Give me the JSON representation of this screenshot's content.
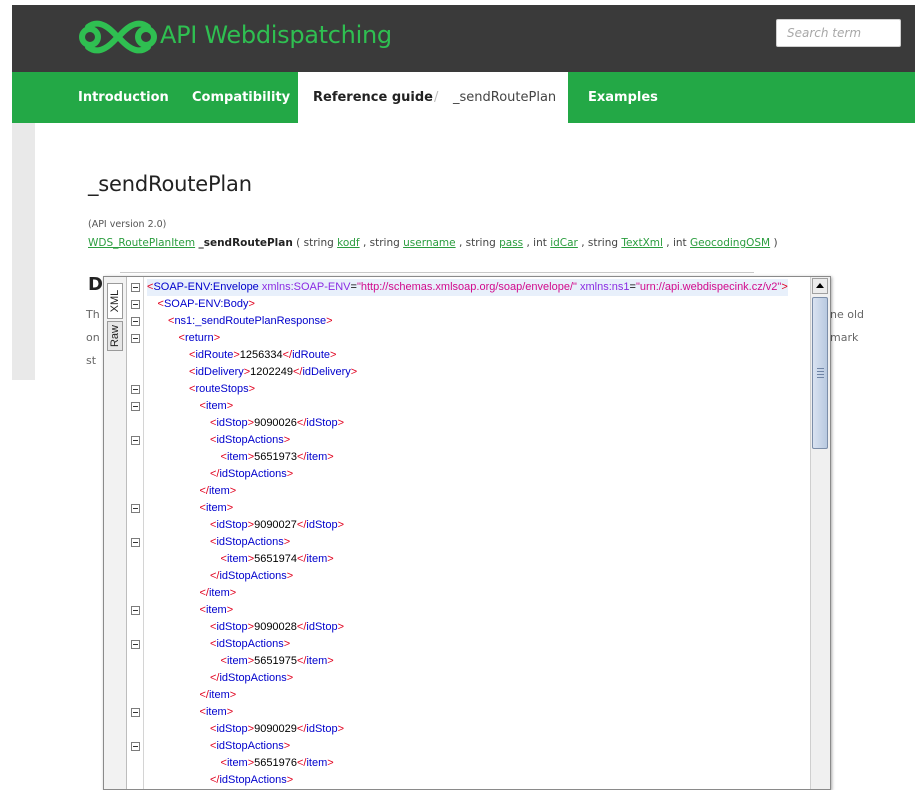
{
  "header": {
    "title": "API Webdispatching",
    "search_placeholder": "Search term",
    "brand_color": "#2fbf51"
  },
  "nav": {
    "items": [
      "Introduction",
      "Compatibility"
    ],
    "breadcrumb": {
      "section": "Reference guide",
      "separator": "/",
      "current": "_sendRoutePlan"
    },
    "examples": "Examples"
  },
  "content": {
    "title": "_sendRoutePlan",
    "api_version": "(API version 2.0)",
    "signature": {
      "return_type": "WDS_RoutePlanItem",
      "function": "_sendRoutePlan",
      "open": " ( ",
      "close": " )",
      "params": [
        {
          "type": "string",
          "name": "kodf"
        },
        {
          "type": "string",
          "name": "username"
        },
        {
          "type": "string",
          "name": "pass"
        },
        {
          "type": "int",
          "name": "idCar"
        },
        {
          "type": "string",
          "name": "TextXml"
        },
        {
          "type": "int",
          "name": "GeocodingOSM"
        }
      ]
    },
    "section_heading_partial": "D",
    "desc_partial": [
      "Th",
      "on",
      "st"
    ],
    "desc_right_partial": [
      "ne old",
      "mark"
    ]
  },
  "viewer": {
    "tabs": [
      "XML",
      "Raw"
    ],
    "lines": [
      {
        "indent": 0,
        "fold": true,
        "hl": true,
        "parts": [
          [
            "br",
            "<"
          ],
          [
            "tg",
            "SOAP-ENV:Envelope"
          ],
          [
            "at",
            " xmlns:SOAP-ENV"
          ],
          [
            "tx",
            "="
          ],
          [
            "av",
            "\"http://schemas.xmlsoap.org/soap/envelope/\""
          ],
          [
            "at",
            " xmlns:ns1"
          ],
          [
            "tx",
            "="
          ],
          [
            "av",
            "\"urn://api.webdispecink.cz/v2\""
          ],
          [
            "br",
            ">"
          ]
        ]
      },
      {
        "indent": 1,
        "fold": true,
        "hl": false,
        "parts": [
          [
            "br",
            "<"
          ],
          [
            "tg",
            "SOAP-ENV:Body"
          ],
          [
            "br",
            ">"
          ]
        ]
      },
      {
        "indent": 2,
        "fold": true,
        "hl": false,
        "parts": [
          [
            "br",
            "<"
          ],
          [
            "tg",
            "ns1:_sendRoutePlanResponse"
          ],
          [
            "br",
            ">"
          ]
        ]
      },
      {
        "indent": 3,
        "fold": true,
        "hl": false,
        "parts": [
          [
            "br",
            "<"
          ],
          [
            "tg",
            "return"
          ],
          [
            "br",
            ">"
          ]
        ]
      },
      {
        "indent": 4,
        "fold": false,
        "hl": false,
        "parts": [
          [
            "br",
            "<"
          ],
          [
            "tg",
            "idRoute"
          ],
          [
            "br",
            ">"
          ],
          [
            "tx",
            "1256334"
          ],
          [
            "br",
            "</"
          ],
          [
            "tg",
            "idRoute"
          ],
          [
            "br",
            ">"
          ]
        ]
      },
      {
        "indent": 4,
        "fold": false,
        "hl": false,
        "parts": [
          [
            "br",
            "<"
          ],
          [
            "tg",
            "idDelivery"
          ],
          [
            "br",
            ">"
          ],
          [
            "tx",
            "1202249"
          ],
          [
            "br",
            "</"
          ],
          [
            "tg",
            "idDelivery"
          ],
          [
            "br",
            ">"
          ]
        ]
      },
      {
        "indent": 4,
        "fold": true,
        "hl": false,
        "parts": [
          [
            "br",
            "<"
          ],
          [
            "tg",
            "routeStops"
          ],
          [
            "br",
            ">"
          ]
        ]
      },
      {
        "indent": 5,
        "fold": true,
        "hl": false,
        "parts": [
          [
            "br",
            "<"
          ],
          [
            "tg",
            "item"
          ],
          [
            "br",
            ">"
          ]
        ]
      },
      {
        "indent": 6,
        "fold": false,
        "hl": false,
        "parts": [
          [
            "br",
            "<"
          ],
          [
            "tg",
            "idStop"
          ],
          [
            "br",
            ">"
          ],
          [
            "tx",
            "9090026"
          ],
          [
            "br",
            "</"
          ],
          [
            "tg",
            "idStop"
          ],
          [
            "br",
            ">"
          ]
        ]
      },
      {
        "indent": 6,
        "fold": true,
        "hl": false,
        "parts": [
          [
            "br",
            "<"
          ],
          [
            "tg",
            "idStopActions"
          ],
          [
            "br",
            ">"
          ]
        ]
      },
      {
        "indent": 7,
        "fold": false,
        "hl": false,
        "parts": [
          [
            "br",
            "<"
          ],
          [
            "tg",
            "item"
          ],
          [
            "br",
            ">"
          ],
          [
            "tx",
            "5651973"
          ],
          [
            "br",
            "</"
          ],
          [
            "tg",
            "item"
          ],
          [
            "br",
            ">"
          ]
        ]
      },
      {
        "indent": 6,
        "fold": false,
        "hl": false,
        "parts": [
          [
            "br",
            "</"
          ],
          [
            "tg",
            "idStopActions"
          ],
          [
            "br",
            ">"
          ]
        ]
      },
      {
        "indent": 5,
        "fold": false,
        "hl": false,
        "parts": [
          [
            "br",
            "</"
          ],
          [
            "tg",
            "item"
          ],
          [
            "br",
            ">"
          ]
        ]
      },
      {
        "indent": 5,
        "fold": true,
        "hl": false,
        "parts": [
          [
            "br",
            "<"
          ],
          [
            "tg",
            "item"
          ],
          [
            "br",
            ">"
          ]
        ]
      },
      {
        "indent": 6,
        "fold": false,
        "hl": false,
        "parts": [
          [
            "br",
            "<"
          ],
          [
            "tg",
            "idStop"
          ],
          [
            "br",
            ">"
          ],
          [
            "tx",
            "9090027"
          ],
          [
            "br",
            "</"
          ],
          [
            "tg",
            "idStop"
          ],
          [
            "br",
            ">"
          ]
        ]
      },
      {
        "indent": 6,
        "fold": true,
        "hl": false,
        "parts": [
          [
            "br",
            "<"
          ],
          [
            "tg",
            "idStopActions"
          ],
          [
            "br",
            ">"
          ]
        ]
      },
      {
        "indent": 7,
        "fold": false,
        "hl": false,
        "parts": [
          [
            "br",
            "<"
          ],
          [
            "tg",
            "item"
          ],
          [
            "br",
            ">"
          ],
          [
            "tx",
            "5651974"
          ],
          [
            "br",
            "</"
          ],
          [
            "tg",
            "item"
          ],
          [
            "br",
            ">"
          ]
        ]
      },
      {
        "indent": 6,
        "fold": false,
        "hl": false,
        "parts": [
          [
            "br",
            "</"
          ],
          [
            "tg",
            "idStopActions"
          ],
          [
            "br",
            ">"
          ]
        ]
      },
      {
        "indent": 5,
        "fold": false,
        "hl": false,
        "parts": [
          [
            "br",
            "</"
          ],
          [
            "tg",
            "item"
          ],
          [
            "br",
            ">"
          ]
        ]
      },
      {
        "indent": 5,
        "fold": true,
        "hl": false,
        "parts": [
          [
            "br",
            "<"
          ],
          [
            "tg",
            "item"
          ],
          [
            "br",
            ">"
          ]
        ]
      },
      {
        "indent": 6,
        "fold": false,
        "hl": false,
        "parts": [
          [
            "br",
            "<"
          ],
          [
            "tg",
            "idStop"
          ],
          [
            "br",
            ">"
          ],
          [
            "tx",
            "9090028"
          ],
          [
            "br",
            "</"
          ],
          [
            "tg",
            "idStop"
          ],
          [
            "br",
            ">"
          ]
        ]
      },
      {
        "indent": 6,
        "fold": true,
        "hl": false,
        "parts": [
          [
            "br",
            "<"
          ],
          [
            "tg",
            "idStopActions"
          ],
          [
            "br",
            ">"
          ]
        ]
      },
      {
        "indent": 7,
        "fold": false,
        "hl": false,
        "parts": [
          [
            "br",
            "<"
          ],
          [
            "tg",
            "item"
          ],
          [
            "br",
            ">"
          ],
          [
            "tx",
            "5651975"
          ],
          [
            "br",
            "</"
          ],
          [
            "tg",
            "item"
          ],
          [
            "br",
            ">"
          ]
        ]
      },
      {
        "indent": 6,
        "fold": false,
        "hl": false,
        "parts": [
          [
            "br",
            "</"
          ],
          [
            "tg",
            "idStopActions"
          ],
          [
            "br",
            ">"
          ]
        ]
      },
      {
        "indent": 5,
        "fold": false,
        "hl": false,
        "parts": [
          [
            "br",
            "</"
          ],
          [
            "tg",
            "item"
          ],
          [
            "br",
            ">"
          ]
        ]
      },
      {
        "indent": 5,
        "fold": true,
        "hl": false,
        "parts": [
          [
            "br",
            "<"
          ],
          [
            "tg",
            "item"
          ],
          [
            "br",
            ">"
          ]
        ]
      },
      {
        "indent": 6,
        "fold": false,
        "hl": false,
        "parts": [
          [
            "br",
            "<"
          ],
          [
            "tg",
            "idStop"
          ],
          [
            "br",
            ">"
          ],
          [
            "tx",
            "9090029"
          ],
          [
            "br",
            "</"
          ],
          [
            "tg",
            "idStop"
          ],
          [
            "br",
            ">"
          ]
        ]
      },
      {
        "indent": 6,
        "fold": true,
        "hl": false,
        "parts": [
          [
            "br",
            "<"
          ],
          [
            "tg",
            "idStopActions"
          ],
          [
            "br",
            ">"
          ]
        ]
      },
      {
        "indent": 7,
        "fold": false,
        "hl": false,
        "parts": [
          [
            "br",
            "<"
          ],
          [
            "tg",
            "item"
          ],
          [
            "br",
            ">"
          ],
          [
            "tx",
            "5651976"
          ],
          [
            "br",
            "</"
          ],
          [
            "tg",
            "item"
          ],
          [
            "br",
            ">"
          ]
        ]
      },
      {
        "indent": 6,
        "fold": false,
        "hl": false,
        "parts": [
          [
            "br",
            "</"
          ],
          [
            "tg",
            "idStopActions"
          ],
          [
            "br",
            ">"
          ]
        ]
      }
    ]
  }
}
